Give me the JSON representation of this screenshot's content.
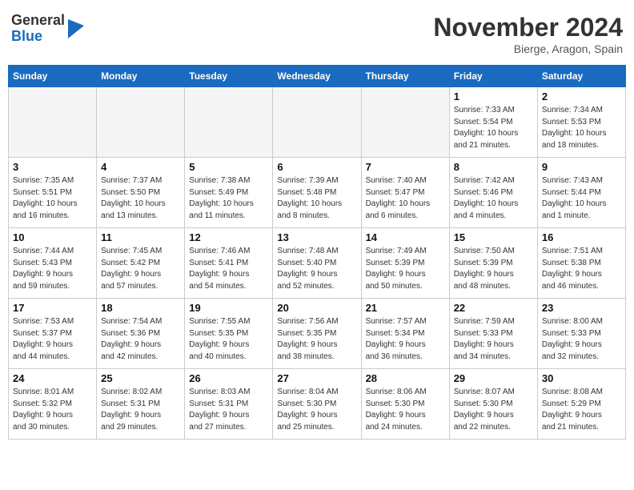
{
  "header": {
    "logo_general": "General",
    "logo_blue": "Blue",
    "month_year": "November 2024",
    "location": "Bierge, Aragon, Spain"
  },
  "weekdays": [
    "Sunday",
    "Monday",
    "Tuesday",
    "Wednesday",
    "Thursday",
    "Friday",
    "Saturday"
  ],
  "weeks": [
    [
      {
        "day": "",
        "info": ""
      },
      {
        "day": "",
        "info": ""
      },
      {
        "day": "",
        "info": ""
      },
      {
        "day": "",
        "info": ""
      },
      {
        "day": "",
        "info": ""
      },
      {
        "day": "1",
        "info": "Sunrise: 7:33 AM\nSunset: 5:54 PM\nDaylight: 10 hours\nand 21 minutes."
      },
      {
        "day": "2",
        "info": "Sunrise: 7:34 AM\nSunset: 5:53 PM\nDaylight: 10 hours\nand 18 minutes."
      }
    ],
    [
      {
        "day": "3",
        "info": "Sunrise: 7:35 AM\nSunset: 5:51 PM\nDaylight: 10 hours\nand 16 minutes."
      },
      {
        "day": "4",
        "info": "Sunrise: 7:37 AM\nSunset: 5:50 PM\nDaylight: 10 hours\nand 13 minutes."
      },
      {
        "day": "5",
        "info": "Sunrise: 7:38 AM\nSunset: 5:49 PM\nDaylight: 10 hours\nand 11 minutes."
      },
      {
        "day": "6",
        "info": "Sunrise: 7:39 AM\nSunset: 5:48 PM\nDaylight: 10 hours\nand 8 minutes."
      },
      {
        "day": "7",
        "info": "Sunrise: 7:40 AM\nSunset: 5:47 PM\nDaylight: 10 hours\nand 6 minutes."
      },
      {
        "day": "8",
        "info": "Sunrise: 7:42 AM\nSunset: 5:46 PM\nDaylight: 10 hours\nand 4 minutes."
      },
      {
        "day": "9",
        "info": "Sunrise: 7:43 AM\nSunset: 5:44 PM\nDaylight: 10 hours\nand 1 minute."
      }
    ],
    [
      {
        "day": "10",
        "info": "Sunrise: 7:44 AM\nSunset: 5:43 PM\nDaylight: 9 hours\nand 59 minutes."
      },
      {
        "day": "11",
        "info": "Sunrise: 7:45 AM\nSunset: 5:42 PM\nDaylight: 9 hours\nand 57 minutes."
      },
      {
        "day": "12",
        "info": "Sunrise: 7:46 AM\nSunset: 5:41 PM\nDaylight: 9 hours\nand 54 minutes."
      },
      {
        "day": "13",
        "info": "Sunrise: 7:48 AM\nSunset: 5:40 PM\nDaylight: 9 hours\nand 52 minutes."
      },
      {
        "day": "14",
        "info": "Sunrise: 7:49 AM\nSunset: 5:39 PM\nDaylight: 9 hours\nand 50 minutes."
      },
      {
        "day": "15",
        "info": "Sunrise: 7:50 AM\nSunset: 5:39 PM\nDaylight: 9 hours\nand 48 minutes."
      },
      {
        "day": "16",
        "info": "Sunrise: 7:51 AM\nSunset: 5:38 PM\nDaylight: 9 hours\nand 46 minutes."
      }
    ],
    [
      {
        "day": "17",
        "info": "Sunrise: 7:53 AM\nSunset: 5:37 PM\nDaylight: 9 hours\nand 44 minutes."
      },
      {
        "day": "18",
        "info": "Sunrise: 7:54 AM\nSunset: 5:36 PM\nDaylight: 9 hours\nand 42 minutes."
      },
      {
        "day": "19",
        "info": "Sunrise: 7:55 AM\nSunset: 5:35 PM\nDaylight: 9 hours\nand 40 minutes."
      },
      {
        "day": "20",
        "info": "Sunrise: 7:56 AM\nSunset: 5:35 PM\nDaylight: 9 hours\nand 38 minutes."
      },
      {
        "day": "21",
        "info": "Sunrise: 7:57 AM\nSunset: 5:34 PM\nDaylight: 9 hours\nand 36 minutes."
      },
      {
        "day": "22",
        "info": "Sunrise: 7:59 AM\nSunset: 5:33 PM\nDaylight: 9 hours\nand 34 minutes."
      },
      {
        "day": "23",
        "info": "Sunrise: 8:00 AM\nSunset: 5:33 PM\nDaylight: 9 hours\nand 32 minutes."
      }
    ],
    [
      {
        "day": "24",
        "info": "Sunrise: 8:01 AM\nSunset: 5:32 PM\nDaylight: 9 hours\nand 30 minutes."
      },
      {
        "day": "25",
        "info": "Sunrise: 8:02 AM\nSunset: 5:31 PM\nDaylight: 9 hours\nand 29 minutes."
      },
      {
        "day": "26",
        "info": "Sunrise: 8:03 AM\nSunset: 5:31 PM\nDaylight: 9 hours\nand 27 minutes."
      },
      {
        "day": "27",
        "info": "Sunrise: 8:04 AM\nSunset: 5:30 PM\nDaylight: 9 hours\nand 25 minutes."
      },
      {
        "day": "28",
        "info": "Sunrise: 8:06 AM\nSunset: 5:30 PM\nDaylight: 9 hours\nand 24 minutes."
      },
      {
        "day": "29",
        "info": "Sunrise: 8:07 AM\nSunset: 5:30 PM\nDaylight: 9 hours\nand 22 minutes."
      },
      {
        "day": "30",
        "info": "Sunrise: 8:08 AM\nSunset: 5:29 PM\nDaylight: 9 hours\nand 21 minutes."
      }
    ]
  ]
}
